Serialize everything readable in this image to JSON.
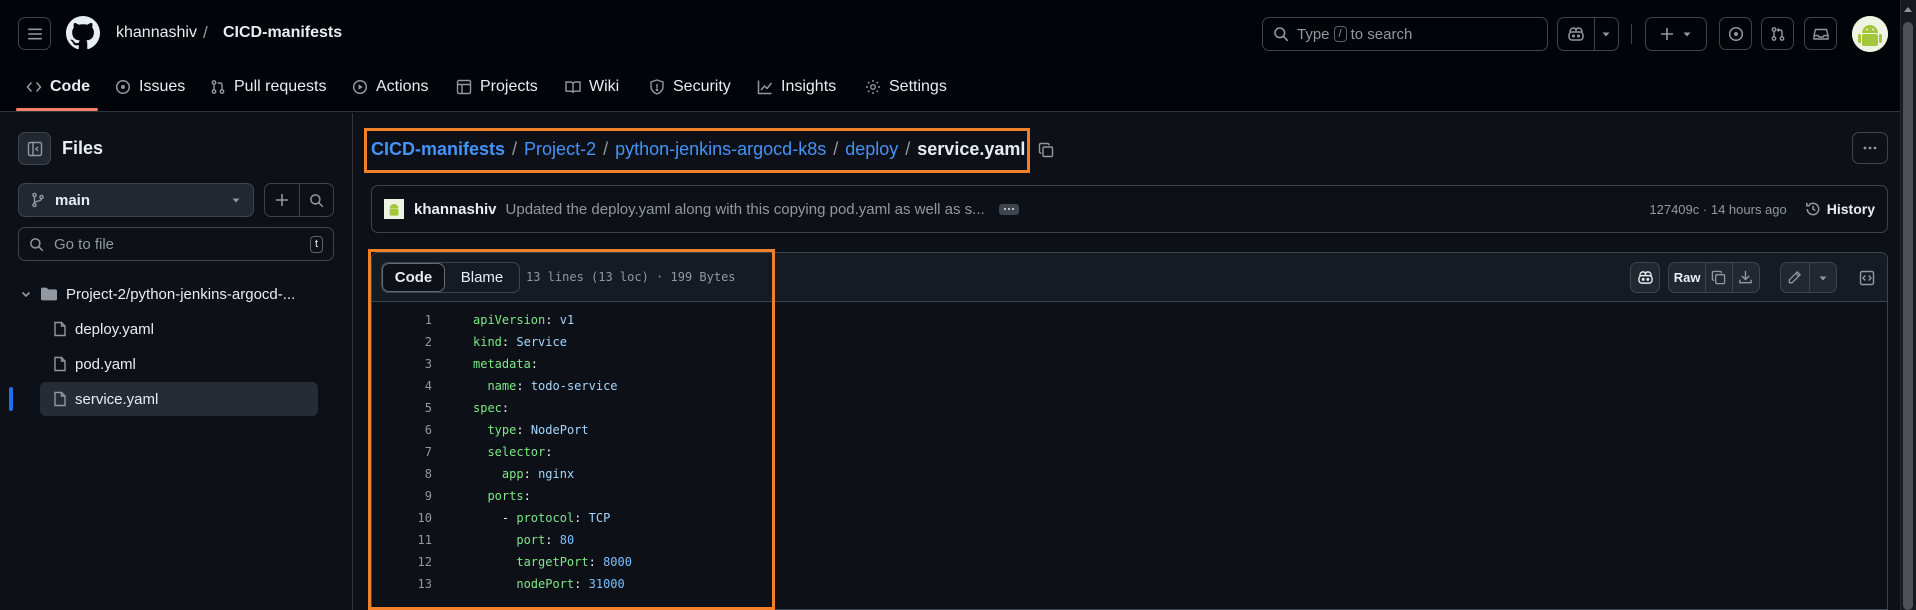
{
  "header": {
    "owner": "khannashiv",
    "separator": "/",
    "repo": "CICD-manifests",
    "search": {
      "prefix": "Type",
      "key": "/",
      "suffix": "to search"
    }
  },
  "repo_nav": {
    "tabs": [
      {
        "label": "Code",
        "icon": "code-icon",
        "active": true
      },
      {
        "label": "Issues",
        "icon": "issue-opened-icon"
      },
      {
        "label": "Pull requests",
        "icon": "git-pull-request-icon"
      },
      {
        "label": "Actions",
        "icon": "play-icon"
      },
      {
        "label": "Projects",
        "icon": "table-icon"
      },
      {
        "label": "Wiki",
        "icon": "book-icon"
      },
      {
        "label": "Security",
        "icon": "shield-icon"
      },
      {
        "label": "Insights",
        "icon": "graph-icon"
      },
      {
        "label": "Settings",
        "icon": "gear-icon"
      }
    ],
    "accent": "#f78166"
  },
  "sidebar": {
    "title": "Files",
    "branch": "main",
    "goto_placeholder": "Go to file",
    "goto_shortcut": "t",
    "tree": {
      "folder": "Project-2/python-jenkins-argocd-...",
      "files": [
        "deploy.yaml",
        "pod.yaml",
        "service.yaml"
      ],
      "selected": "service.yaml"
    }
  },
  "breadcrumbs": {
    "items": [
      "CICD-manifests",
      "Project-2",
      "python-jenkins-argocd-k8s",
      "deploy"
    ],
    "current": "service.yaml",
    "separator": "/"
  },
  "commit": {
    "author": "khannashiv",
    "message": "Updated the deploy.yaml along with this copying pod.yaml as well as s...",
    "sha": "127409c",
    "dot": "·",
    "time": "14 hours ago",
    "history_label": "History"
  },
  "file_view": {
    "tabs": [
      "Code",
      "Blame"
    ],
    "active_tab": "Code",
    "info": "13 lines (13 loc) · 199 Bytes",
    "raw_label": "Raw",
    "lines": [
      {
        "n": "1",
        "indent": "",
        "key": "apiVersion",
        "colon": ":",
        "value": "v1",
        "vtype": "v"
      },
      {
        "n": "2",
        "indent": "",
        "key": "kind",
        "colon": ":",
        "value": "Service",
        "vtype": "v"
      },
      {
        "n": "3",
        "indent": "",
        "key": "metadata",
        "colon": ":",
        "value": "",
        "vtype": "v"
      },
      {
        "n": "4",
        "indent": "  ",
        "key": "name",
        "colon": ":",
        "value": "todo-service",
        "vtype": "v"
      },
      {
        "n": "5",
        "indent": "",
        "key": "spec",
        "colon": ":",
        "value": "",
        "vtype": "v"
      },
      {
        "n": "6",
        "indent": "  ",
        "key": "type",
        "colon": ":",
        "value": "NodePort",
        "vtype": "v"
      },
      {
        "n": "7",
        "indent": "  ",
        "key": "selector",
        "colon": ":",
        "value": "",
        "vtype": "v"
      },
      {
        "n": "8",
        "indent": "    ",
        "key": "app",
        "colon": ":",
        "value": "nginx",
        "vtype": "v"
      },
      {
        "n": "9",
        "indent": "  ",
        "key": "ports",
        "colon": ":",
        "value": "",
        "vtype": "v"
      },
      {
        "n": "10",
        "indent": "    - ",
        "key": "protocol",
        "colon": ":",
        "value": "TCP",
        "vtype": "v"
      },
      {
        "n": "11",
        "indent": "      ",
        "key": "port",
        "colon": ":",
        "value": "80",
        "vtype": "n"
      },
      {
        "n": "12",
        "indent": "      ",
        "key": "targetPort",
        "colon": ":",
        "value": "8000",
        "vtype": "n"
      },
      {
        "n": "13",
        "indent": "      ",
        "key": "nodePort",
        "colon": ":",
        "value": "31000",
        "vtype": "n"
      }
    ]
  },
  "highlight_color": "#f0812a"
}
